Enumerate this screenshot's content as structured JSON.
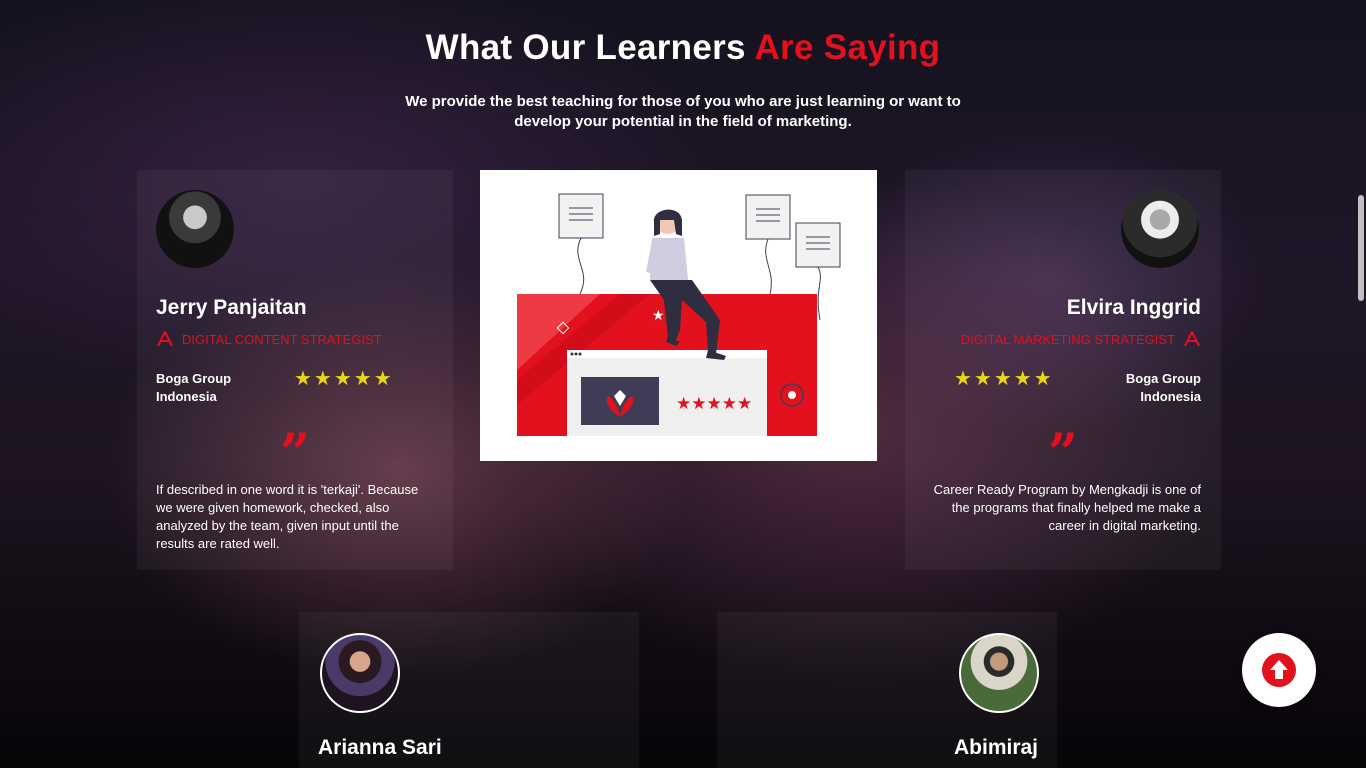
{
  "section": {
    "title_part1": "What Our Learners",
    "title_part2": "Are Saying",
    "subtitle": "We provide the best teaching for those of you who are just learning or want to develop your potential in the field of marketing."
  },
  "colors": {
    "accent": "#e3101e",
    "star": "#e6d61a"
  },
  "testimonials": [
    {
      "name": "Jerry Panjaitan",
      "role": "DIGITAL CONTENT STRATEGIST",
      "role_icon": "compass-icon",
      "company": "Boga Group Indonesia",
      "rating": 5,
      "stars": "★★★★★",
      "quote_icon": "quote-icon",
      "review": "If described in one word it is 'terkaji'. Because we were given homework, checked, also analyzed by the team, given input until the results are rated well."
    },
    {
      "name": "Elvira Inggrid",
      "role": "DIGITAL MARKETING STRATEGIST",
      "role_icon": "compass-icon",
      "company": "Boga Group Indonesia",
      "rating": 5,
      "stars": "★★★★★",
      "quote_icon": "quote-icon",
      "review": "Career Ready Program by Mengkadji is one of the programs that finally helped me make a career in digital marketing."
    }
  ],
  "more_testimonials": [
    {
      "name": "Arianna Sari"
    },
    {
      "name": "Abimiraj"
    }
  ],
  "scroll_top_icon": "arrow-up-circle-icon"
}
